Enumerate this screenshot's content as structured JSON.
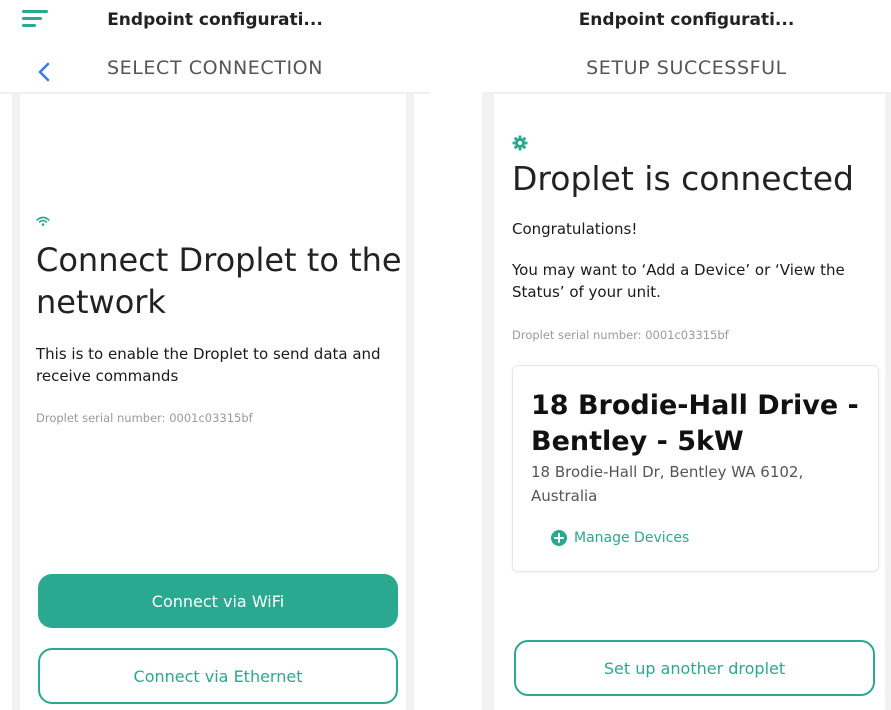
{
  "left": {
    "topbar_title": "Endpoint configurati...",
    "subtitle": "SELECT CONNECTION",
    "heading": "Connect Droplet to the network",
    "description": "This is to enable the Droplet to send data and receive commands",
    "serial": "Droplet serial number: 0001c03315bf",
    "wifi_button": "Connect via WiFi",
    "ethernet_button": "Connect via Ethernet"
  },
  "right": {
    "topbar_title": "Endpoint configurati...",
    "subtitle": "SETUP SUCCESSFUL",
    "heading": "Droplet is connected",
    "congrats": "Congratulations!",
    "message": "You may want to ‘Add a Device’ or ‘View the Status’ of your unit.",
    "serial": "Droplet serial number: 0001c03315bf",
    "site": {
      "title": "18 Brodie-Hall Drive - Bentley - 5kW",
      "address": "18 Brodie-Hall Dr, Bentley WA 6102, Australia",
      "manage_link": "Manage Devices"
    },
    "another_button": "Set up another droplet"
  },
  "icons": {
    "menu": "hamburger-menu-icon",
    "back": "chevron-left-icon",
    "wifi": "wifi-icon",
    "success": "cog-icon",
    "add": "plus-circle-icon"
  },
  "colors": {
    "accent": "#2aa890",
    "back_arrow": "#3b7ddd",
    "muted_text": "#9a9a9a"
  }
}
